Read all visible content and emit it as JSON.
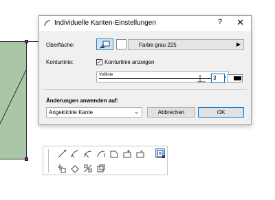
{
  "dialog": {
    "title": "Individuelle Kanten-Einstellungen",
    "help_label": "?",
    "close_label": "✕",
    "surface_label": "Oberfläche:",
    "surface_value": "Farbe grau 225",
    "contour_label": "Konturlinie:",
    "contour_checkbox_label": "Konturlinie anzeigen",
    "contour_checked": true,
    "line_type": "Volllinie",
    "pen_number": "3",
    "apply_heading": "Änderungen anwenden auf:",
    "apply_selected": "Angeklickte Kante",
    "cancel_label": "Abbrechen",
    "ok_label": "OK"
  },
  "toolbar": {
    "tools": [
      "edge-tool-1-icon",
      "edge-tool-2-icon",
      "edge-tool-3-icon",
      "edge-tool-4-icon",
      "edge-tool-5-icon",
      "edge-tool-6-icon",
      "edge-tool-7-icon",
      "edge-settings-icon",
      "add-point-icon",
      "rotate-icon",
      "mirror-icon",
      "offset-icon"
    ]
  }
}
